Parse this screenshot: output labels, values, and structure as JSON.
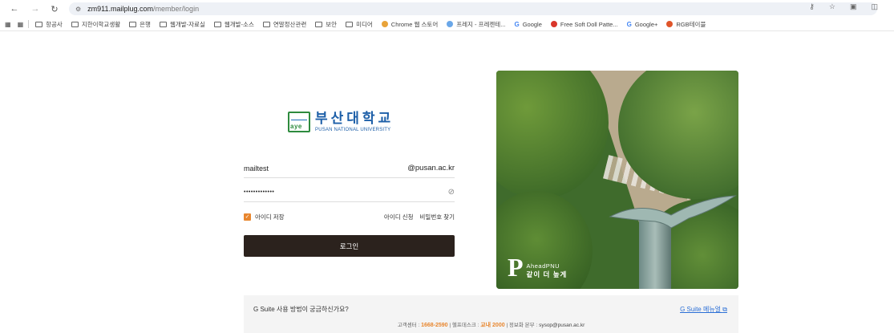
{
  "browser": {
    "url_host": "zm911.mailplug.com",
    "url_path": "/member/login",
    "bookmarks": [
      {
        "label": "항공사",
        "type": "folder"
      },
      {
        "label": "지한이학교생활",
        "type": "folder"
      },
      {
        "label": "은행",
        "type": "folder"
      },
      {
        "label": "웹개발-자료실",
        "type": "folder"
      },
      {
        "label": "웹개발-소스",
        "type": "folder"
      },
      {
        "label": "연말정산관련",
        "type": "folder"
      },
      {
        "label": "보안",
        "type": "folder"
      },
      {
        "label": "미디어",
        "type": "folder"
      },
      {
        "label": "Chrome 웹 스토어",
        "type": "site",
        "color": "#e8a33a"
      },
      {
        "label": "프레지 - 프레젠테...",
        "type": "site",
        "color": "#6aa7e8"
      },
      {
        "label": "Google",
        "type": "google"
      },
      {
        "label": "Free Soft Doll Patte...",
        "type": "site",
        "color": "#d9362b"
      },
      {
        "label": "Google+",
        "type": "google"
      },
      {
        "label": "RGB테이블",
        "type": "site",
        "color": "#e0552a"
      }
    ]
  },
  "logo": {
    "mark_text": "aye",
    "name_ko": "부산대학교",
    "name_en": "PUSAN NATIONAL UNIVERSITY"
  },
  "login": {
    "username": "mailtest",
    "domain": "@pusan.ac.kr",
    "password_masked": "•••••••••••••",
    "save_id_label": "아이디 저장",
    "save_id_checked": true,
    "id_request": "아이디 신청",
    "find_password": "비밀번호 찾기",
    "submit": "로그인"
  },
  "photo": {
    "brand_top": "AheadPNU",
    "brand_bottom": "같이 더 높게"
  },
  "info": {
    "question": "G Suite 사용 방법이 궁금하신가요?",
    "guide_link": "G Suite 메뉴얼",
    "center_label": "고객센터 :",
    "center_phone": "1668-2590",
    "helpdesk_label": "| 헬프데스크 :",
    "helpdesk_phone": "교내 2000",
    "dept_label": "| 정보화 본부 :",
    "email": "sysop@pusan.ac.kr"
  },
  "colors": {
    "accent": "#e8862e",
    "button": "#2b221d",
    "link": "#2b6fd6",
    "brand": "#1d5fa8"
  }
}
